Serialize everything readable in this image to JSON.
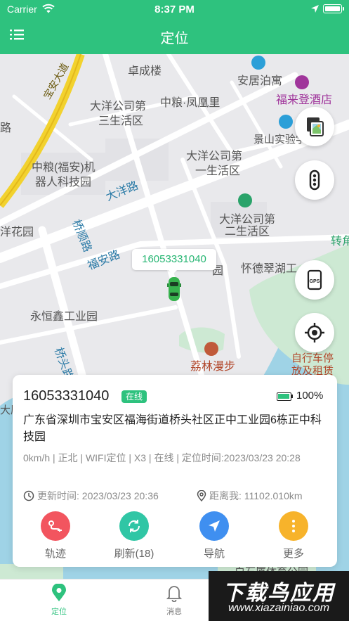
{
  "status_bar": {
    "carrier": "Carrier",
    "time": "8:37 PM"
  },
  "header": {
    "title": "定位",
    "menu_icon": "menu-icon"
  },
  "map": {
    "labels": {
      "zhuocheng": "卓成楼",
      "anju": "安居泊寓",
      "fulai": "福来登酒店",
      "jingshan": "景山实验学",
      "dayang3a": "大洋公司第",
      "dayang3b": "三生活区",
      "zhongliang": "中粮·凤凰里",
      "dayang1a": "大洋公司第",
      "dayang1b": "一生活区",
      "robot1": "中粮(福安)机",
      "robot2": "器人科技园",
      "dayang_road": "大洋路",
      "dayang2a": "大洋公司第",
      "dayang2b": "二生活区",
      "yanghuayuan": "洋花园",
      "qiaoshun": "桥顺路",
      "fuan": "福安路",
      "zhuanjiao": "转角",
      "huaide": "怀德翠湖工",
      "park_frag": "园",
      "yongheng": "永恒鑫工业园",
      "qiaotou": "桥头路",
      "lilin": "荔林漫步",
      "bike1": "自行车停",
      "bike2": "放及租赁",
      "baoan_road": "宝安大道",
      "lu_frag": "路",
      "baishi": "白石厦体育公园",
      "daxia": "大厦"
    },
    "device_tag": "16053331040"
  },
  "card": {
    "device_name": "16053331040",
    "status_badge": "在线",
    "battery_percent": "100%",
    "battery_level": 1.0,
    "address": "广东省深圳市宝安区福海街道桥头社区正中工业园6栋正中科技园",
    "meta": "0km/h | 正北 | WIFI定位 | X3 | 在线 | 定位时间:2023/03/23 20:28",
    "update_time": "更新时间: 2023/03/23 20:36",
    "distance": "距离我: 11102.010km",
    "actions": [
      {
        "label": "轨迹",
        "color": "#f2555f",
        "icon": "track-icon"
      },
      {
        "label": "刷新(18)",
        "color": "#30c6a5",
        "icon": "refresh-icon"
      },
      {
        "label": "导航",
        "color": "#3f8ff0",
        "icon": "navigate-icon"
      },
      {
        "label": "更多",
        "color": "#f7b32b",
        "icon": "more-icon"
      }
    ]
  },
  "tabbar": {
    "tabs": [
      {
        "label": "定位",
        "active": true,
        "icon": "location-pin-icon"
      },
      {
        "label": "消息",
        "active": false,
        "icon": "bell-icon"
      }
    ]
  },
  "watermark": {
    "line1": "下载鸟应用",
    "line2": "www.xiazainiao.com"
  },
  "colors": {
    "brand": "#2ec27e",
    "water": "#9fd3e6",
    "park": "#cde9d3"
  }
}
